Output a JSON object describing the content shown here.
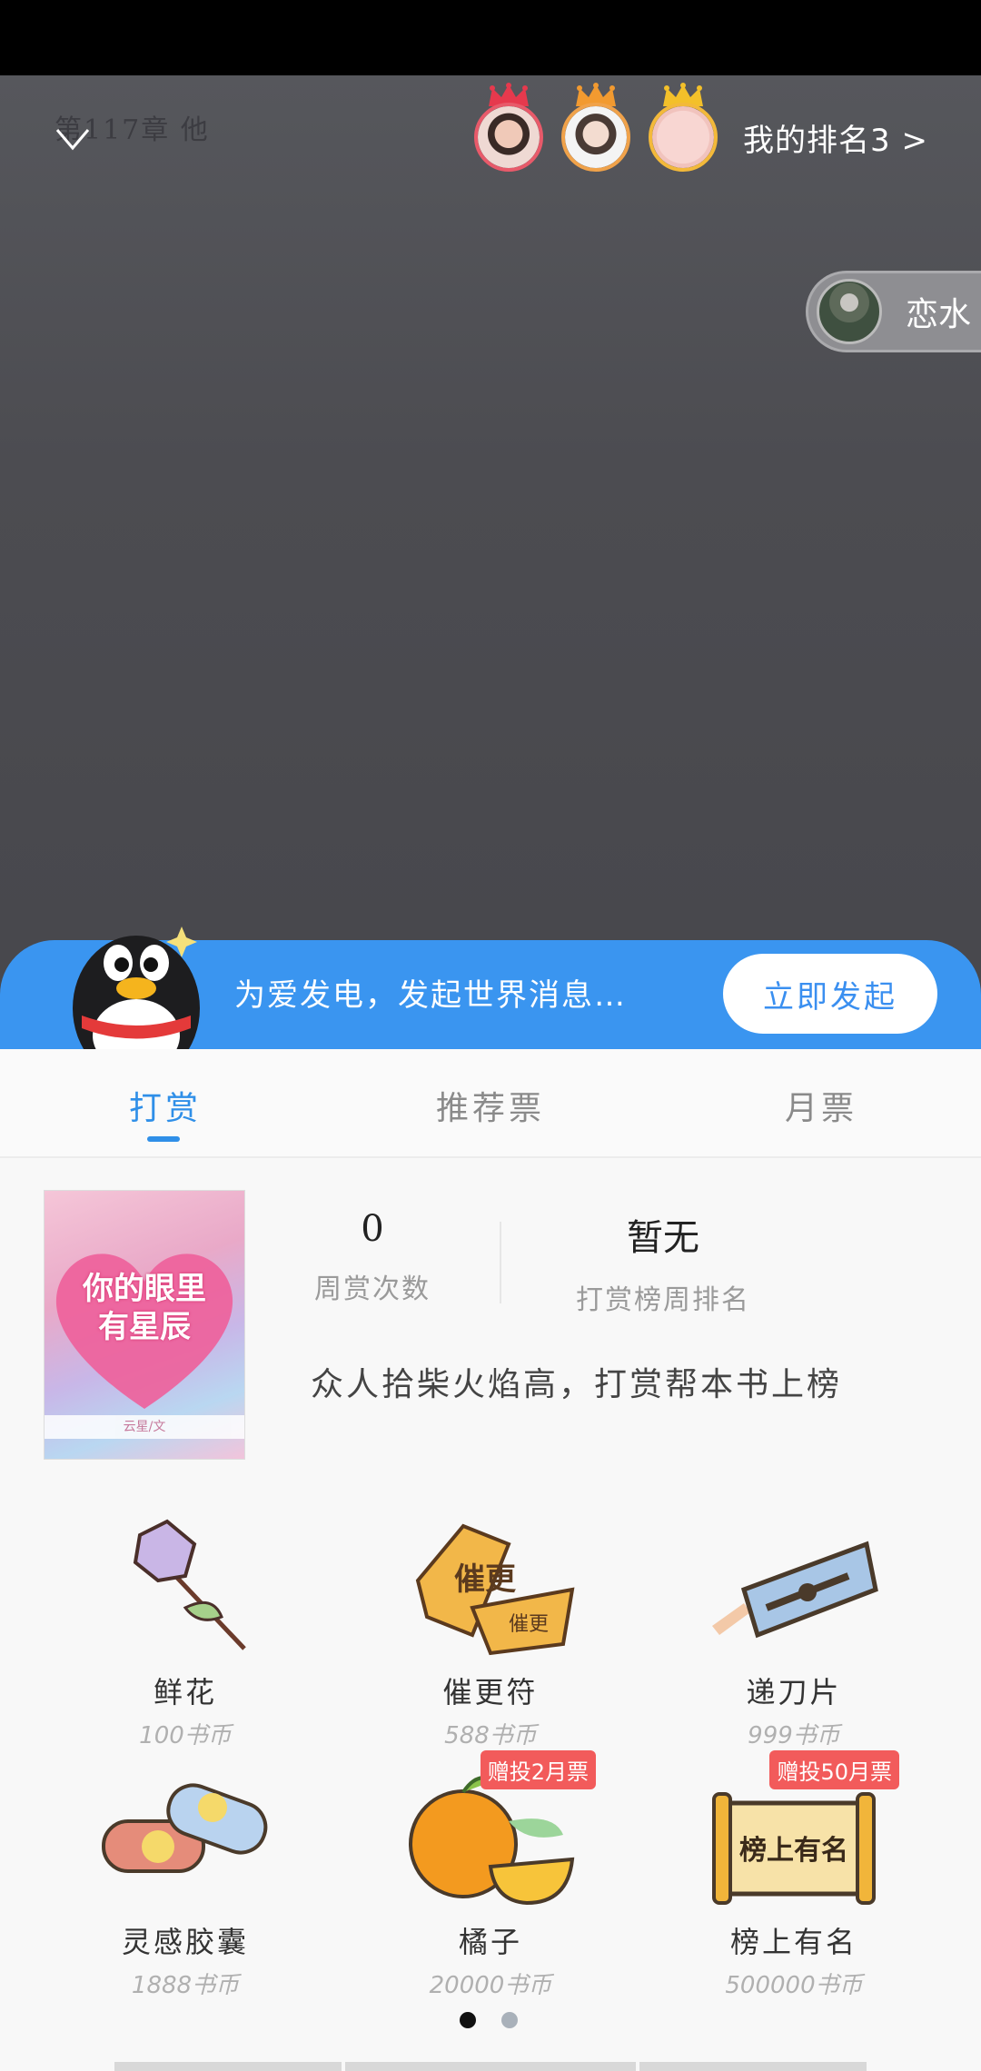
{
  "header": {
    "chapter_title": "第117章 他",
    "my_rank_label": "我的排名3 >"
  },
  "rankers": [
    {
      "ring_color": "#e85a6a",
      "crown_color": "#e6394d"
    },
    {
      "ring_color": "#f0a24a",
      "crown_color": "#f29a30"
    },
    {
      "ring_color": "#f3b93a",
      "crown_color": "#f3c02a"
    }
  ],
  "floating_user": {
    "name": "恋水"
  },
  "banner": {
    "text": "为爱发电，发起世界消息…",
    "button_label": "立即发起",
    "color": "#3a95f0"
  },
  "tabs": [
    {
      "label": "打赏",
      "active": true
    },
    {
      "label": "推荐票",
      "active": false
    },
    {
      "label": "月票",
      "active": false
    }
  ],
  "book": {
    "cover_title_line1": "你的眼里",
    "cover_title_line2": "有星辰",
    "cover_author": "云星/文"
  },
  "stats": {
    "weekly_count_value": "0",
    "weekly_count_label": "周赏次数",
    "rank_value": "暂无",
    "rank_label": "打赏榜周排名"
  },
  "slogan": "众人拾柴火焰高，打赏帮本书上榜",
  "gifts": [
    {
      "name": "鲜花",
      "price": "100书币",
      "icon": "rose-icon"
    },
    {
      "name": "催更符",
      "price": "588书币",
      "icon": "talisman-icon"
    },
    {
      "name": "递刀片",
      "price": "999书币",
      "icon": "blade-icon"
    },
    {
      "name": "灵感胶囊",
      "price": "1888书币",
      "icon": "capsule-icon"
    },
    {
      "name": "橘子",
      "price": "20000书币",
      "icon": "orange-icon",
      "badge": "赠投2月票"
    },
    {
      "name": "榜上有名",
      "price": "500000书币",
      "icon": "scroll-icon",
      "badge": "赠投50月票",
      "icon_text": "榜上有名"
    }
  ],
  "talisman_text": {
    "big": "催更",
    "small": "催更"
  },
  "pager": {
    "current": 1,
    "total": 2
  },
  "accent_color": "#2f8fe8"
}
